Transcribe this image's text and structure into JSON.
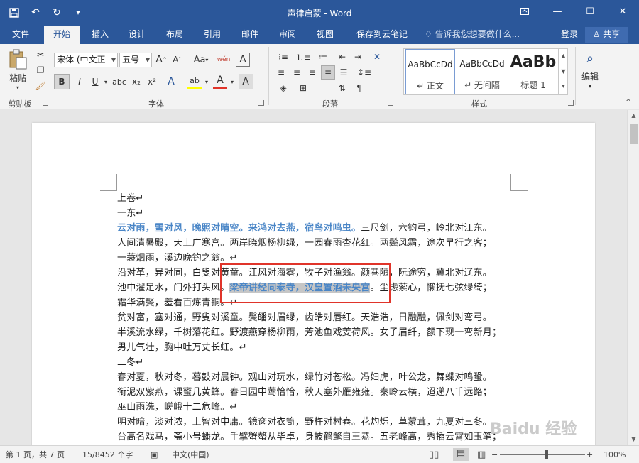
{
  "window": {
    "title": "声律启蒙 - Word",
    "controls": [
      "ribbon-display-icon",
      "minimize-icon",
      "maximize-icon",
      "close-icon"
    ]
  },
  "qat": {
    "icons": [
      "save-icon",
      "undo-icon",
      "redo-icon",
      "customize-icon"
    ]
  },
  "tabs": [
    {
      "label": "文件"
    },
    {
      "label": "开始",
      "active": true
    },
    {
      "label": "插入"
    },
    {
      "label": "设计"
    },
    {
      "label": "布局"
    },
    {
      "label": "引用"
    },
    {
      "label": "邮件"
    },
    {
      "label": "审阅"
    },
    {
      "label": "视图"
    },
    {
      "label": "保存到云笔记"
    }
  ],
  "tellme": "告诉我您想要做什么...",
  "login": "登录",
  "share": "共享",
  "ribbon": {
    "clipboard": {
      "paste": "粘贴",
      "label": "剪贴板"
    },
    "font": {
      "font_name": "宋体 (中文正",
      "font_size": "五号",
      "change_case": "Aa",
      "phonetic": "wén",
      "bold": "B",
      "italic": "I",
      "underline": "U",
      "strike": "abc",
      "subscript": "x₂",
      "superscript": "x²",
      "highlight": "ab",
      "fontcolor": "A",
      "clearfmt": "A",
      "label": "字体"
    },
    "paragraph": {
      "label": "段落"
    },
    "styles": {
      "items": [
        {
          "sample": "AaBbCcDd",
          "name": "↵ 正文"
        },
        {
          "sample": "AaBbCcDd",
          "name": "↵ 无间隔"
        },
        {
          "sample": "AaBb",
          "name": "标题 1"
        }
      ],
      "label": "样式"
    },
    "editing": {
      "label": "编辑"
    }
  },
  "document": {
    "lines": [
      {
        "text": "上卷↵"
      },
      {
        "text": "一东↵"
      },
      {
        "blue": "云对雨，雪对风，晚照对晴空。来鸿对去燕，宿鸟对鸣虫。",
        "text": "三尺剑，六钧弓，岭北对江东。"
      },
      {
        "text": "人间清暑殿，天上广寒宫。两岸晓烟杨柳绿，一园春雨杏花红。两鬓风霜，途次早行之客；"
      },
      {
        "text": "一蓑烟雨，溪边晚钓之翁。↵"
      },
      {
        "text": "沿对革，异对同，白叟对黄童。江风对海雾，牧子对渔翁。颜巷陋，阮途穷，冀北对辽东。"
      },
      {
        "pre": "池中濯足水，门外打头风。",
        "sel": "梁帝讲经同泰寺，汉皇置酒未央宫",
        "post": "。尘虑萦心，懒抚七弦绿绮；"
      },
      {
        "text": "霜华满鬓，羞看百炼青铜。↵"
      },
      {
        "text": "贫对富，塞对通，野叟对溪童。鬓皤对眉绿，齿皓对唇红。天浩浩，日融融，佩剑对弯弓。"
      },
      {
        "text": "半溪流水绿，千树落花红。野渡燕穿杨柳雨，芳池鱼戏芰荷风。女子眉纤，额下现一弯新月；"
      },
      {
        "text": "男儿气壮，胸中吐万丈长虹。↵"
      },
      {
        "text": "二冬↵"
      },
      {
        "text": "春对夏，秋对冬，暮鼓对晨钟。观山对玩水，绿竹对苍松。冯妇虎，叶公龙，舞蝶对鸣蛩。"
      },
      {
        "text": "衔泥双紫燕，课蜜几黄蜂。春日园中莺恰恰，秋天塞外雁雍雍。秦岭云横，迢递八千远路；"
      },
      {
        "text": "巫山雨洗，嵯峨十二危峰。↵"
      },
      {
        "text": "明对暗，淡对浓，上智对中庸。镜奁对衣笥，野杵对村舂。花灼烁，草蒙茸，九夏对三冬。"
      },
      {
        "text": "台高名戏马，斋小号蟠龙。手擘蟹螯从毕卓，身披鹤氅自王恭。五老峰高，秀插云霄如玉笔；"
      }
    ]
  },
  "status": {
    "page": "第 1 页，共 7 页",
    "words": "15/8452 个字",
    "lang": "中文(中国)",
    "zoom": "100%"
  },
  "watermark": "Baidu 经验"
}
